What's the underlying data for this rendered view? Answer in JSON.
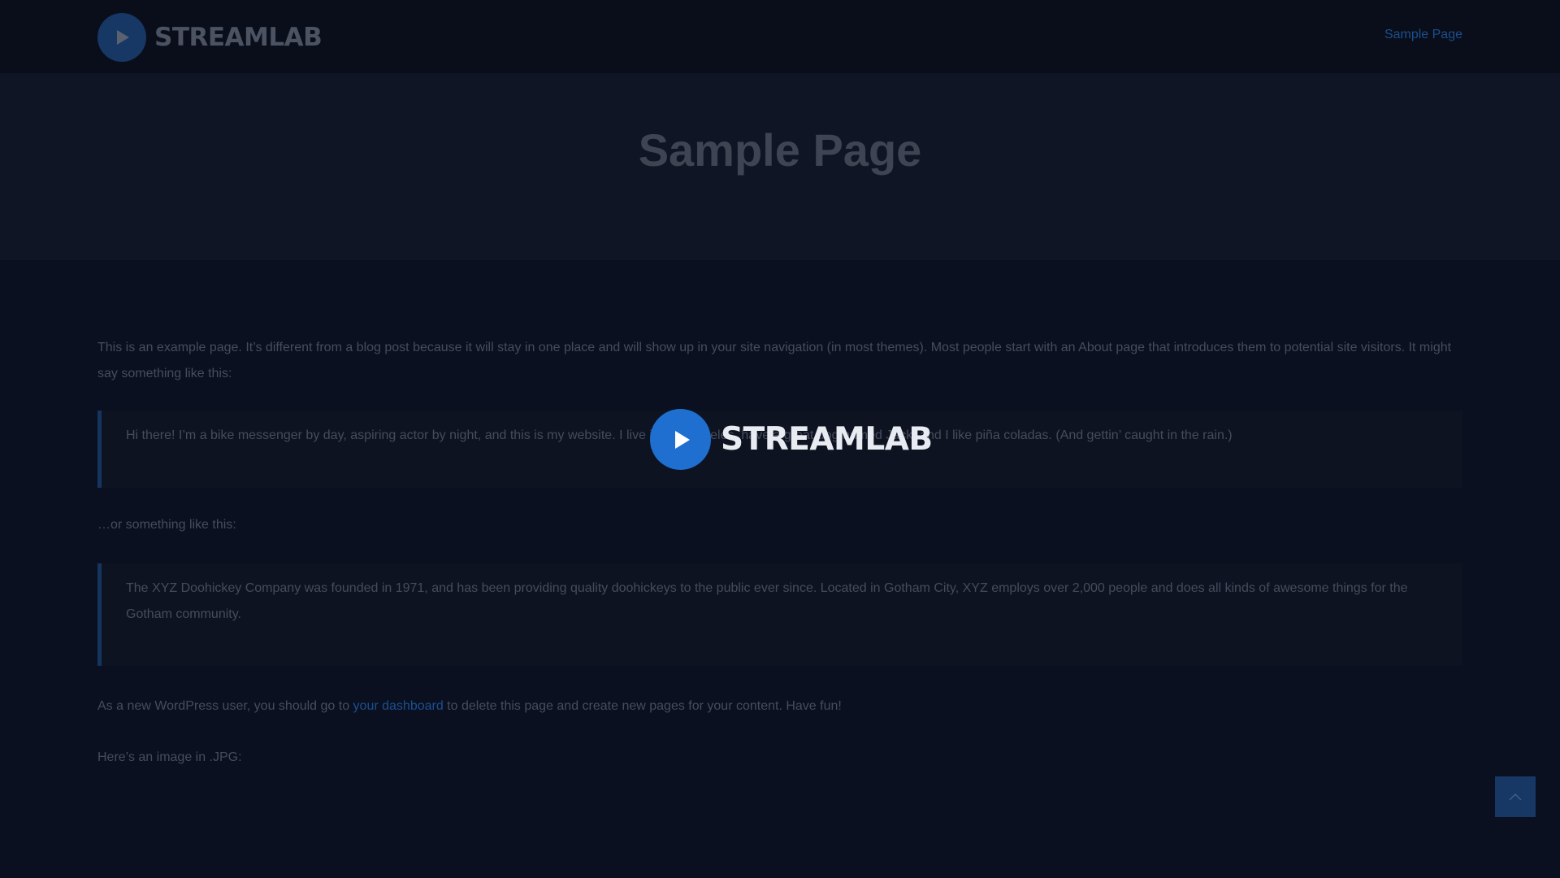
{
  "header": {
    "logo_text": "STREAMLAB",
    "nav_link": "Sample Page"
  },
  "hero": {
    "title": "Sample Page"
  },
  "content": {
    "intro": "This is an example page. It’s different from a blog post because it will stay in one place and will show up in your site navigation (in most themes). Most people start with an About page that introduces them to potential site visitors. It might say something like this:",
    "quote1": "Hi there! I’m a bike messenger by day, aspiring actor by night, and this is my website. I live in Los Angeles, have a great dog named Jack, and I like piña coladas. (And gettin’ caught in the rain.)",
    "or_text": "…or something like this:",
    "quote2": "The XYZ Doohickey Company was founded in 1971, and has been providing quality doohickeys to the public ever since. Located in Gotham City, XYZ employs over 2,000 people and does all kinds of awesome things for the Gotham community.",
    "dashboard_before": "As a new WordPress user, you should go to ",
    "dashboard_link": "your dashboard",
    "dashboard_after": " to delete this page and create new pages for your content. Have fun!",
    "image_text": "Here’s an image in .JPG:"
  },
  "overlay": {
    "logo_text": "STREAMLAB"
  },
  "icons": {
    "logo": "play-icon",
    "back_to_top": "chevron-up-icon"
  },
  "colors": {
    "background": "#0b1020",
    "accent": "#1e6fd0",
    "link": "#1b4f8f"
  }
}
